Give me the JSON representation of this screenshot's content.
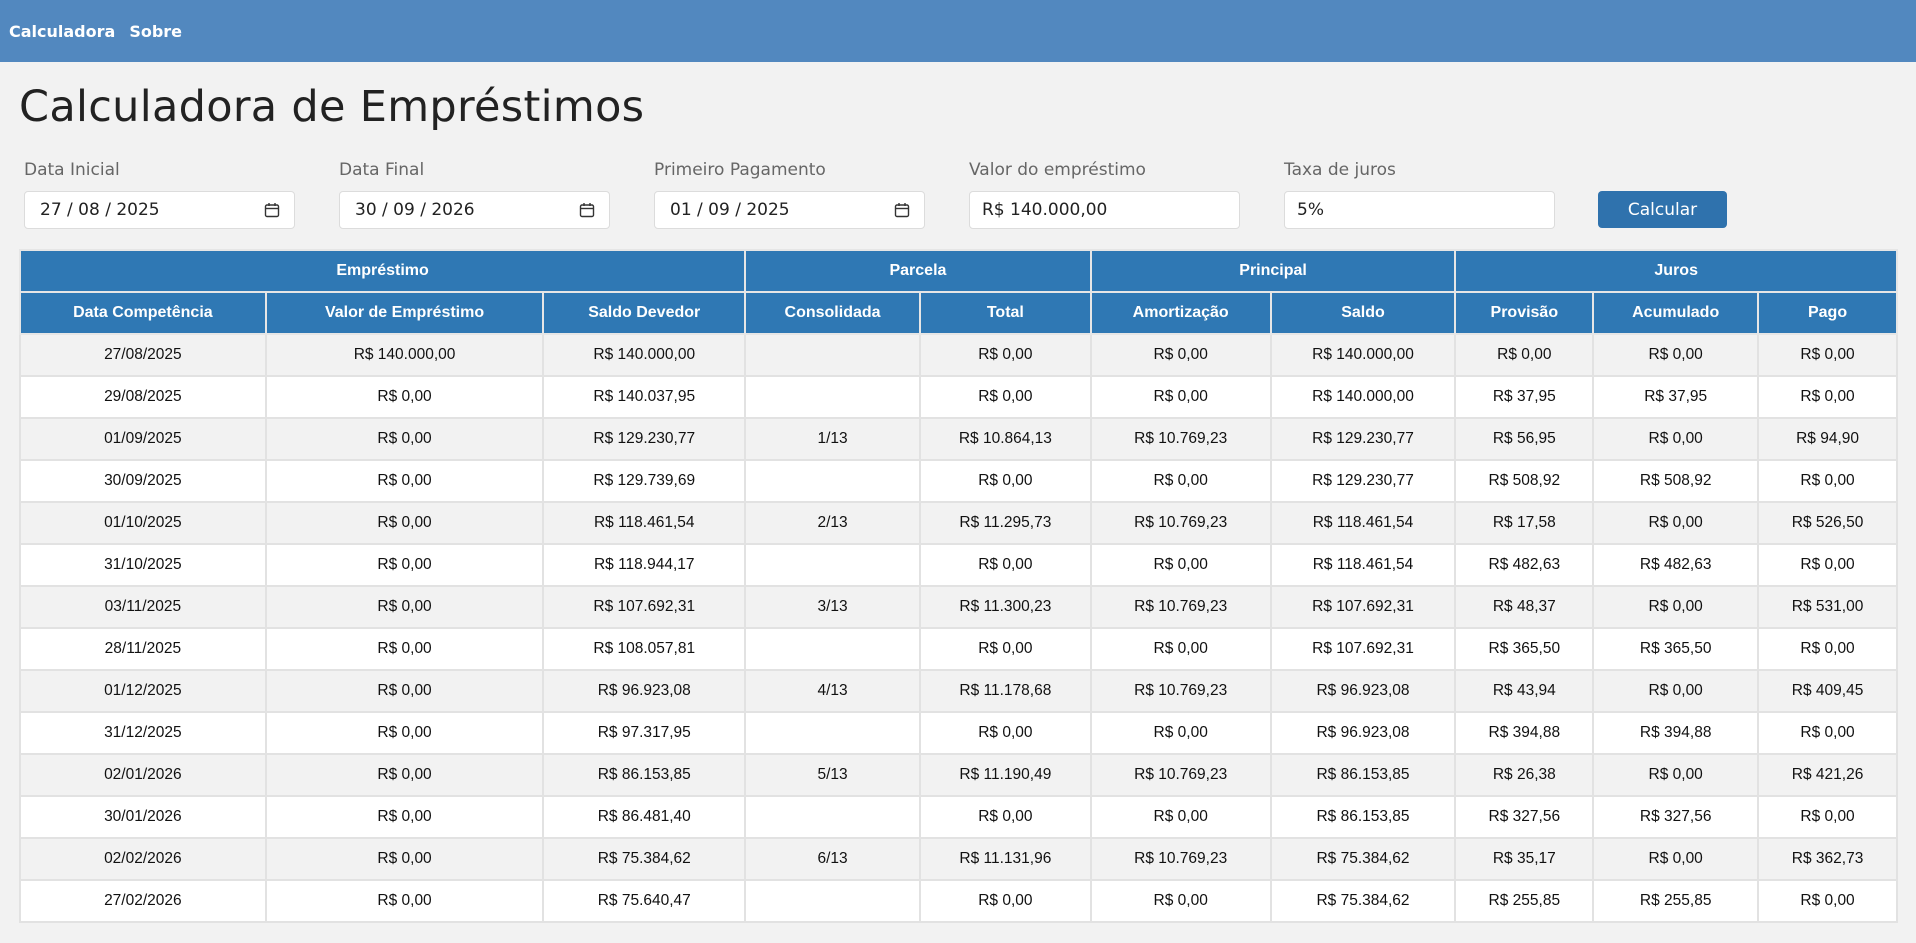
{
  "nav": {
    "items": [
      "Calculadora",
      "Sobre"
    ]
  },
  "page_title": "Calculadora de Empréstimos",
  "form": {
    "fields": [
      {
        "label": "Data Inicial",
        "value": "27 / 08 / 2025",
        "type": "date"
      },
      {
        "label": "Data Final",
        "value": "30 / 09 / 2026",
        "type": "date"
      },
      {
        "label": "Primeiro Pagamento",
        "value": "01 / 09 / 2025",
        "type": "date"
      },
      {
        "label": "Valor do empréstimo",
        "value": "R$ 140.000,00",
        "type": "text"
      },
      {
        "label": "Taxa de juros",
        "value": "5%",
        "type": "text"
      }
    ],
    "submit_label": "Calcular"
  },
  "table": {
    "groups": [
      {
        "label": "Empréstimo",
        "span": 3
      },
      {
        "label": "Parcela",
        "span": 2
      },
      {
        "label": "Principal",
        "span": 2
      },
      {
        "label": "Juros",
        "span": 3
      }
    ],
    "columns": [
      "Data Competência",
      "Valor de Empréstimo",
      "Saldo Devedor",
      "Consolidada",
      "Total",
      "Amortização",
      "Saldo",
      "Provisão",
      "Acumulado",
      "Pago"
    ],
    "rows": [
      [
        "27/08/2025",
        "R$ 140.000,00",
        "R$ 140.000,00",
        "",
        "R$ 0,00",
        "R$ 0,00",
        "R$ 140.000,00",
        "R$ 0,00",
        "R$ 0,00",
        "R$ 0,00"
      ],
      [
        "29/08/2025",
        "R$ 0,00",
        "R$ 140.037,95",
        "",
        "R$ 0,00",
        "R$ 0,00",
        "R$ 140.000,00",
        "R$ 37,95",
        "R$ 37,95",
        "R$ 0,00"
      ],
      [
        "01/09/2025",
        "R$ 0,00",
        "R$ 129.230,77",
        "1/13",
        "R$ 10.864,13",
        "R$ 10.769,23",
        "R$ 129.230,77",
        "R$ 56,95",
        "R$ 0,00",
        "R$ 94,90"
      ],
      [
        "30/09/2025",
        "R$ 0,00",
        "R$ 129.739,69",
        "",
        "R$ 0,00",
        "R$ 0,00",
        "R$ 129.230,77",
        "R$ 508,92",
        "R$ 508,92",
        "R$ 0,00"
      ],
      [
        "01/10/2025",
        "R$ 0,00",
        "R$ 118.461,54",
        "2/13",
        "R$ 11.295,73",
        "R$ 10.769,23",
        "R$ 118.461,54",
        "R$ 17,58",
        "R$ 0,00",
        "R$ 526,50"
      ],
      [
        "31/10/2025",
        "R$ 0,00",
        "R$ 118.944,17",
        "",
        "R$ 0,00",
        "R$ 0,00",
        "R$ 118.461,54",
        "R$ 482,63",
        "R$ 482,63",
        "R$ 0,00"
      ],
      [
        "03/11/2025",
        "R$ 0,00",
        "R$ 107.692,31",
        "3/13",
        "R$ 11.300,23",
        "R$ 10.769,23",
        "R$ 107.692,31",
        "R$ 48,37",
        "R$ 0,00",
        "R$ 531,00"
      ],
      [
        "28/11/2025",
        "R$ 0,00",
        "R$ 108.057,81",
        "",
        "R$ 0,00",
        "R$ 0,00",
        "R$ 107.692,31",
        "R$ 365,50",
        "R$ 365,50",
        "R$ 0,00"
      ],
      [
        "01/12/2025",
        "R$ 0,00",
        "R$ 96.923,08",
        "4/13",
        "R$ 11.178,68",
        "R$ 10.769,23",
        "R$ 96.923,08",
        "R$ 43,94",
        "R$ 0,00",
        "R$ 409,45"
      ],
      [
        "31/12/2025",
        "R$ 0,00",
        "R$ 97.317,95",
        "",
        "R$ 0,00",
        "R$ 0,00",
        "R$ 96.923,08",
        "R$ 394,88",
        "R$ 394,88",
        "R$ 0,00"
      ],
      [
        "02/01/2026",
        "R$ 0,00",
        "R$ 86.153,85",
        "5/13",
        "R$ 11.190,49",
        "R$ 10.769,23",
        "R$ 86.153,85",
        "R$ 26,38",
        "R$ 0,00",
        "R$ 421,26"
      ],
      [
        "30/01/2026",
        "R$ 0,00",
        "R$ 86.481,40",
        "",
        "R$ 0,00",
        "R$ 0,00",
        "R$ 86.153,85",
        "R$ 327,56",
        "R$ 327,56",
        "R$ 0,00"
      ],
      [
        "02/02/2026",
        "R$ 0,00",
        "R$ 75.384,62",
        "6/13",
        "R$ 11.131,96",
        "R$ 10.769,23",
        "R$ 75.384,62",
        "R$ 35,17",
        "R$ 0,00",
        "R$ 362,73"
      ],
      [
        "27/02/2026",
        "R$ 0,00",
        "R$ 75.640,47",
        "",
        "R$ 0,00",
        "R$ 0,00",
        "R$ 75.384,62",
        "R$ 255,85",
        "R$ 255,85",
        "R$ 0,00"
      ]
    ]
  },
  "colors": {
    "navbar": "#5288bf",
    "accent": "#2f78b4",
    "button": "#2f72ad"
  },
  "icons": {
    "date_field": "calendar-icon"
  }
}
